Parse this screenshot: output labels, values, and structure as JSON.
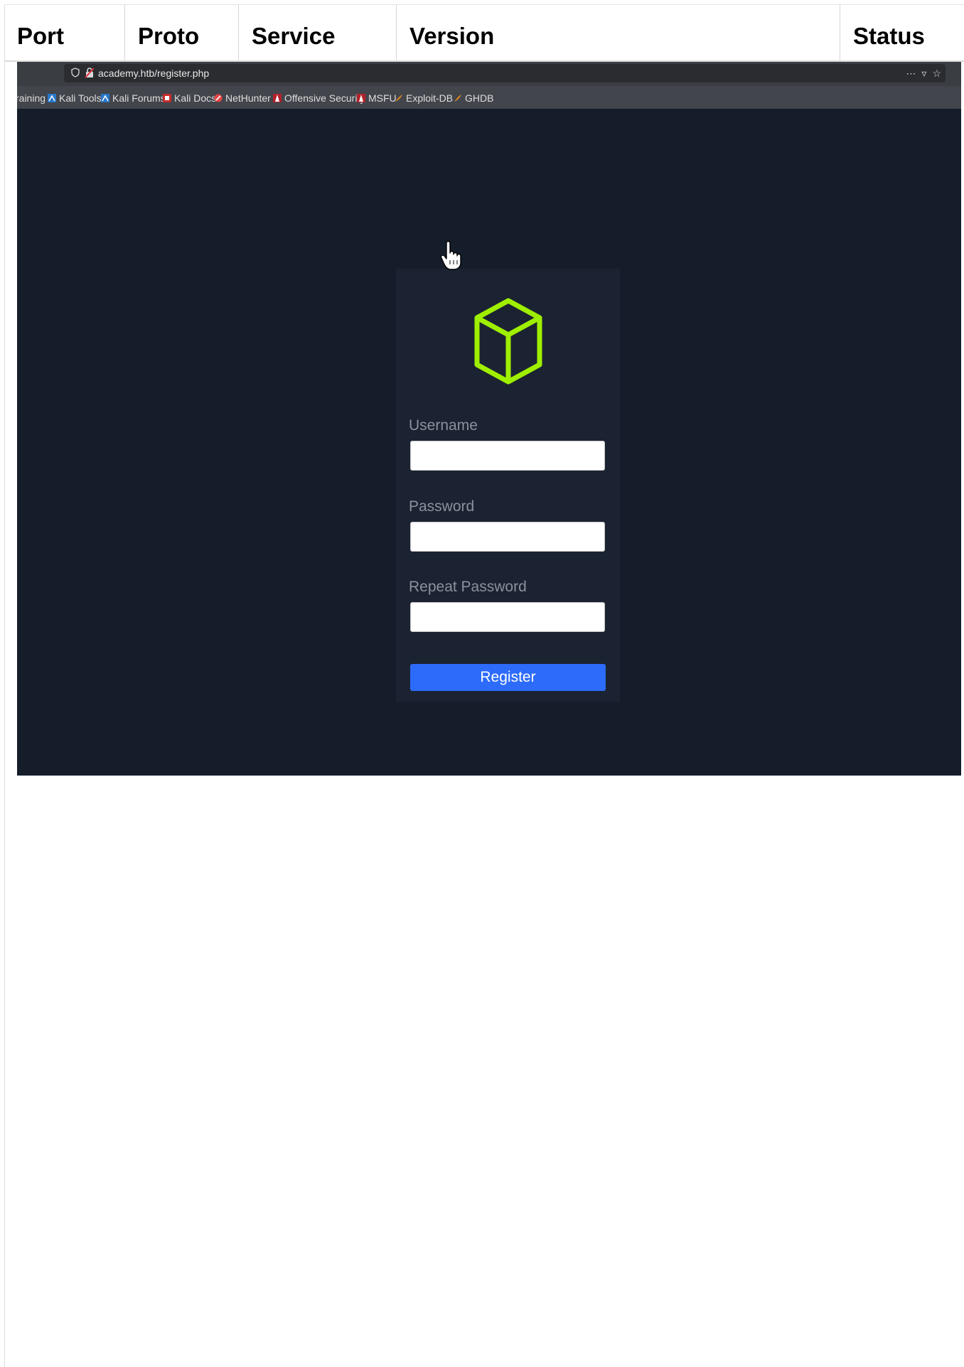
{
  "table": {
    "columns": [
      "Port",
      "Proto",
      "Service",
      "Version",
      "Status"
    ]
  },
  "browser": {
    "url": "academy.htb/register.php",
    "actions": [
      "⋯",
      "▿",
      "☆"
    ],
    "bookmarks": [
      {
        "label": "raining",
        "icon": ""
      },
      {
        "label": "Kali Tools",
        "icon": "kali-dragon-icon"
      },
      {
        "label": "Kali Forums",
        "icon": "kali-dragon-icon"
      },
      {
        "label": "Kali Docs",
        "icon": "kali-docs-icon"
      },
      {
        "label": "NetHunter",
        "icon": "nethunter-icon"
      },
      {
        "label": "Offensive Security",
        "icon": "offsec-icon"
      },
      {
        "label": "MSFU",
        "icon": "offsec-icon"
      },
      {
        "label": "Exploit-DB",
        "icon": "exploit-db-icon"
      },
      {
        "label": "GHDB",
        "icon": "exploit-db-icon"
      }
    ]
  },
  "form": {
    "logo": "cube-logo",
    "username_label": "Username",
    "username_value": "",
    "password_label": "Password",
    "password_value": "",
    "repeat_password_label": "Repeat Password",
    "repeat_password_value": "",
    "submit_label": "Register"
  },
  "colors": {
    "page_bg": "#151d2b",
    "card_bg": "#1b2332",
    "logo": "#9fef00",
    "button": "#2d6bfa",
    "label": "#8b929d"
  }
}
